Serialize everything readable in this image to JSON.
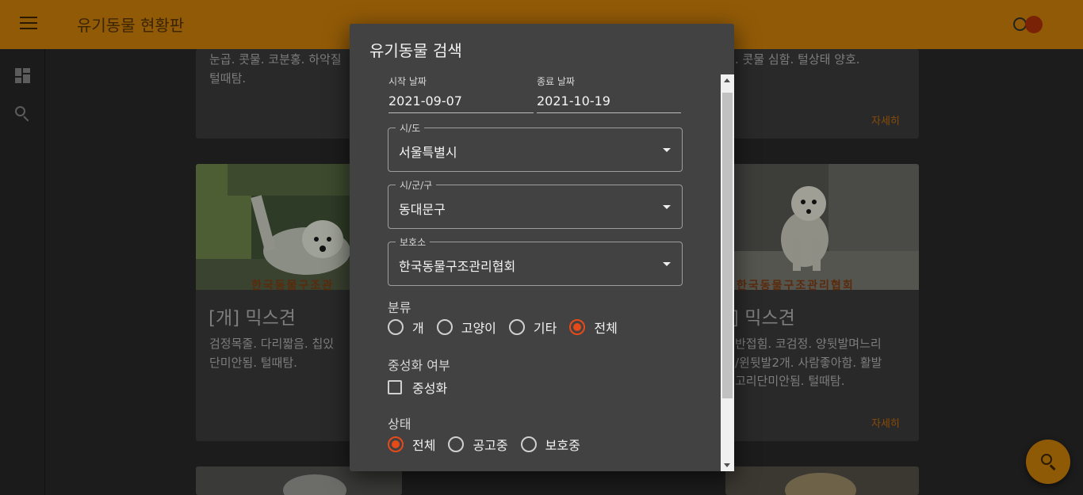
{
  "app": {
    "title": "유기동물 현황판"
  },
  "cards": {
    "top_left_text": "눈곱. 콧물. 코분홍. 하악질\n털때탐.",
    "top_right_text": ". 콧물 심함. 털상태 양호.",
    "top_right_link": "자세히",
    "mid_left_title": "[개] 믹스견",
    "mid_left_text": "검정목줄. 다리짧음. 칩있\n단미안됨. 털때탐.",
    "mid_left_watermark": "한국동물구조관",
    "mid_right_title": "] 믹스견",
    "mid_right_text": "반접힘. 코검정. 양뒷발며느리\n/윈뒷발2개. 사람좋아함. 활발\n고리단미안됨. 털때탐.",
    "mid_right_watermark": "한국동물구조관리협회",
    "mid_right_link": "자세히"
  },
  "dialog": {
    "title": "유기동물 검색",
    "start_date": {
      "label": "시작 날짜",
      "value": "2021-09-07"
    },
    "end_date": {
      "label": "종료 날짜",
      "value": "2021-10-19"
    },
    "sido": {
      "label": "시/도",
      "value": "서울특별시"
    },
    "sigungu": {
      "label": "시/군/구",
      "value": "동대문구"
    },
    "shelter": {
      "label": "보호소",
      "value": "한국동물구조관리협회"
    },
    "kind": {
      "label": "분류",
      "options": [
        "개",
        "고양이",
        "기타",
        "전체"
      ],
      "selected": "전체"
    },
    "neuter": {
      "label": "중성화 여부",
      "checkbox_label": "중성화",
      "checked": false
    },
    "state": {
      "label": "상태",
      "options": [
        "전체",
        "공고중",
        "보호중"
      ],
      "selected": "전체"
    }
  },
  "icons": {
    "menu": "menu-icon",
    "dashboard": "dashboard-icon",
    "search": "search-icon",
    "theme_toggle": "theme-toggle-icon"
  },
  "colors": {
    "appbar": "#915a07",
    "accent": "#e64a19",
    "dialog_bg": "#424242",
    "fab": "#8f5a06"
  }
}
